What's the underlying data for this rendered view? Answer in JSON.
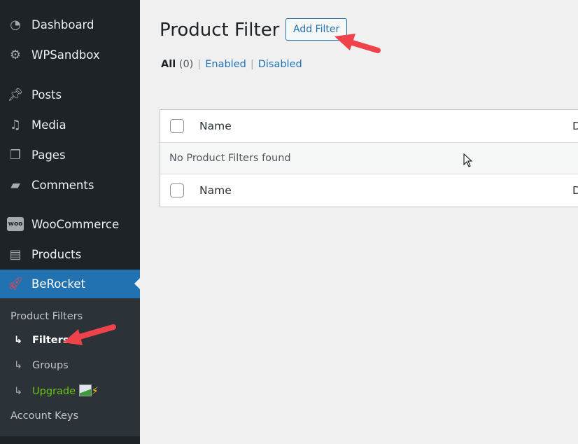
{
  "sidebar": {
    "items": [
      {
        "label": "Dashboard",
        "icon": "dashboard-icon"
      },
      {
        "label": "WPSandbox",
        "icon": "gear-icon"
      },
      {
        "label": "Posts",
        "icon": "pin-icon"
      },
      {
        "label": "Media",
        "icon": "media-icon"
      },
      {
        "label": "Pages",
        "icon": "pages-icon"
      },
      {
        "label": "Comments",
        "icon": "comment-icon"
      },
      {
        "label": "WooCommerce",
        "icon": "woo-icon"
      },
      {
        "label": "Products",
        "icon": "archive-icon"
      },
      {
        "label": "BeRocket",
        "icon": "rocket-icon"
      }
    ],
    "submenu": {
      "heading": "Product Filters",
      "filters": "Filters",
      "groups": "Groups",
      "upgrade": "Upgrade",
      "account_keys": "Account Keys"
    }
  },
  "page": {
    "title": "Product Filter",
    "add_button": "Add Filter",
    "views": {
      "all": "All",
      "all_count": "(0)",
      "enabled": "Enabled",
      "disabled": "Disabled",
      "separator": "|"
    }
  },
  "table": {
    "col_name": "Name",
    "col_second": "D",
    "empty": "No Product Filters found"
  },
  "colors": {
    "accent": "#2271b1",
    "sidebar": "#1d2327",
    "upgrade": "#6bc518",
    "annotation_arrow": "#f0424a"
  }
}
